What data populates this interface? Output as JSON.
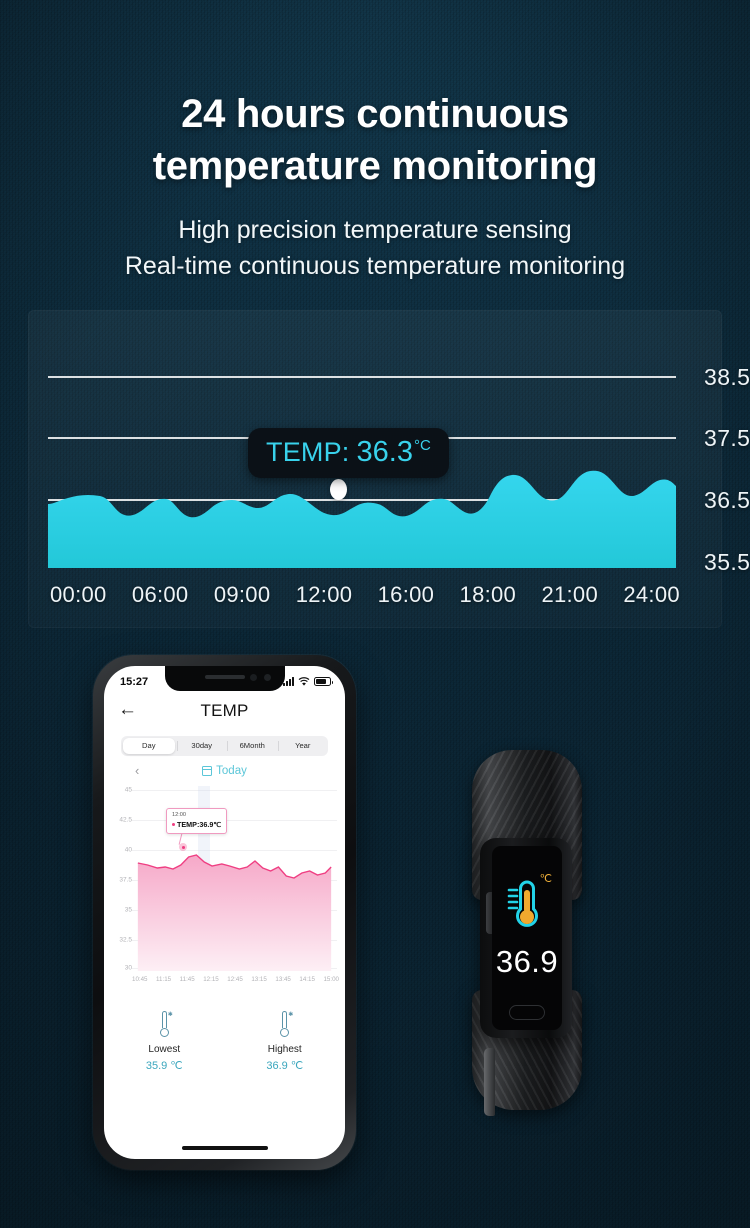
{
  "page": {
    "title_line1": "24 hours continuous",
    "title_line2": "temperature monitoring",
    "subtitle_line1": "High precision temperature sensing",
    "subtitle_line2": "Real-time continuous temperature monitoring",
    "background_color": "#0d2a3a",
    "accent_color": "#35d2ea"
  },
  "chart_data": {
    "type": "area",
    "title": "24 hours continuous temperature monitoring",
    "xlabel": "",
    "ylabel": "",
    "ylim": [
      35.0,
      39.0
    ],
    "yticks": [
      "38.5",
      "37.5",
      "36.5",
      "35.5"
    ],
    "ytick_values": [
      38.5,
      37.5,
      36.5,
      35.5
    ],
    "categories": [
      "00:00",
      "06:00",
      "09:00",
      "12:00",
      "16:00",
      "18:00",
      "21:00",
      "24:00"
    ],
    "grid": true,
    "gridlines_at": [
      38.5,
      37.5,
      36.5
    ],
    "legend": "none",
    "series": [
      {
        "name": "TEMP",
        "unit": "°C",
        "color": "#2ccfe6",
        "values": [
          36.5,
          36.55,
          36.4,
          36.3,
          36.45,
          36.3,
          36.25,
          36.4,
          36.5,
          36.45,
          36.35,
          36.4,
          36.5,
          36.45,
          36.3,
          36.25,
          36.35,
          36.5,
          36.45,
          36.3,
          36.25,
          36.35,
          36.45,
          36.7,
          36.8,
          36.6,
          36.55,
          36.85,
          36.8,
          36.6,
          36.75,
          36.85,
          36.7,
          36.75
        ]
      }
    ],
    "annotation": {
      "label": "TEMP:",
      "value": "36.3",
      "unit": "°C",
      "at_x": "12:00",
      "marker": "white-dot"
    }
  },
  "phone": {
    "statusbar": {
      "time": "15:27",
      "signal_icon": "signal-bars-icon",
      "wifi_icon": "wifi-icon",
      "battery_icon": "battery-icon"
    },
    "header": {
      "back_icon": "back-arrow-icon",
      "title": "TEMP"
    },
    "tabs": [
      {
        "label": "Day",
        "active": true
      },
      {
        "label": "30day",
        "active": false
      },
      {
        "label": "6Month",
        "active": false
      },
      {
        "label": "Year",
        "active": false
      }
    ],
    "date_nav": {
      "prev_icon": "chevron-left-icon",
      "calendar_icon": "calendar-icon",
      "label": "Today"
    },
    "chart": {
      "type": "area",
      "yticks": [
        "45",
        "42.5",
        "40",
        "37.5",
        "35",
        "32.5",
        "30"
      ],
      "ytick_values": [
        45,
        42.5,
        40,
        37.5,
        35,
        32.5,
        30
      ],
      "ylim": [
        30,
        45
      ],
      "xticks": [
        "10:45",
        "11:15",
        "11:45",
        "12:15",
        "12:45",
        "13:15",
        "13:45",
        "14:15",
        "15:00"
      ],
      "series_color": "#ef3e82",
      "values": [
        36.6,
        36.5,
        36.4,
        36.45,
        36.4,
        36.5,
        36.85,
        36.9,
        36.7,
        36.6,
        36.65,
        36.6,
        36.5,
        36.55,
        36.7,
        36.5,
        36.45,
        36.55,
        36.3,
        36.25,
        36.35,
        36.5,
        36.45,
        36.3,
        36.35,
        36.5,
        36.35,
        36.3,
        36.4,
        36.55
      ],
      "tooltip": {
        "time": "12:00",
        "text": "TEMP:36.9℃"
      }
    },
    "stats": [
      {
        "icon": "thermometer-low-icon",
        "label": "Lowest",
        "value": "35.9 ℃"
      },
      {
        "icon": "thermometer-high-icon",
        "label": "Highest",
        "value": "36.9 ℃"
      }
    ]
  },
  "wristband": {
    "screen": {
      "thermometer_icon": "thermometer-icon",
      "unit": "℃",
      "value": "36.9",
      "home_button_icon": "home-button-icon"
    }
  }
}
